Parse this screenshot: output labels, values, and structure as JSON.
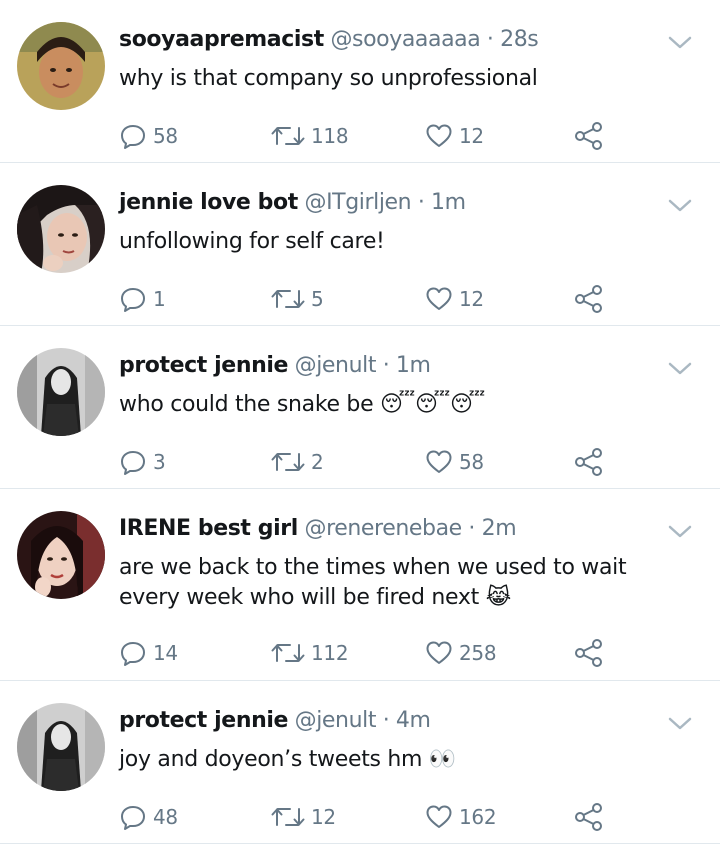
{
  "tweets": [
    {
      "name": "sooyaapremacist",
      "handle": "@sooyaaaaaa",
      "dot": "·",
      "time": "28s",
      "text": "why is that company so unprofessional",
      "emoji": "",
      "replies": "58",
      "retweets": "118",
      "likes": "12"
    },
    {
      "name": "jennie love bot",
      "handle": "@ITgirljen",
      "dot": "·",
      "time": "1m",
      "text": "unfollowing for self care!",
      "emoji": "",
      "replies": "1",
      "retweets": "5",
      "likes": "12"
    },
    {
      "name": "protect jennie",
      "handle": "@jenult",
      "dot": "·",
      "time": "1m",
      "text": "who could the snake be ",
      "emoji": "😴😴😴",
      "replies": "3",
      "retweets": "2",
      "likes": "58"
    },
    {
      "name": "IRENE best girl",
      "handle": "@renerenebae",
      "dot": "·",
      "time": "2m",
      "text": "are we back to the times when we used to wait every week who will be fired next ",
      "emoji": "😹",
      "replies": "14",
      "retweets": "112",
      "likes": "258"
    },
    {
      "name": "protect jennie",
      "handle": "@jenult",
      "dot": "·",
      "time": "4m",
      "text": "joy and doyeon’s tweets hm ",
      "emoji": "👀",
      "replies": "48",
      "retweets": "12",
      "likes": "162"
    }
  ],
  "icons": {
    "reply": "reply-icon",
    "retweet": "retweet-icon",
    "like": "heart-icon",
    "share": "share-icon",
    "menu": "chevron-down-icon"
  },
  "colors": {
    "text": "#14171a",
    "secondary": "#657786",
    "divider": "#e1e8ed"
  }
}
